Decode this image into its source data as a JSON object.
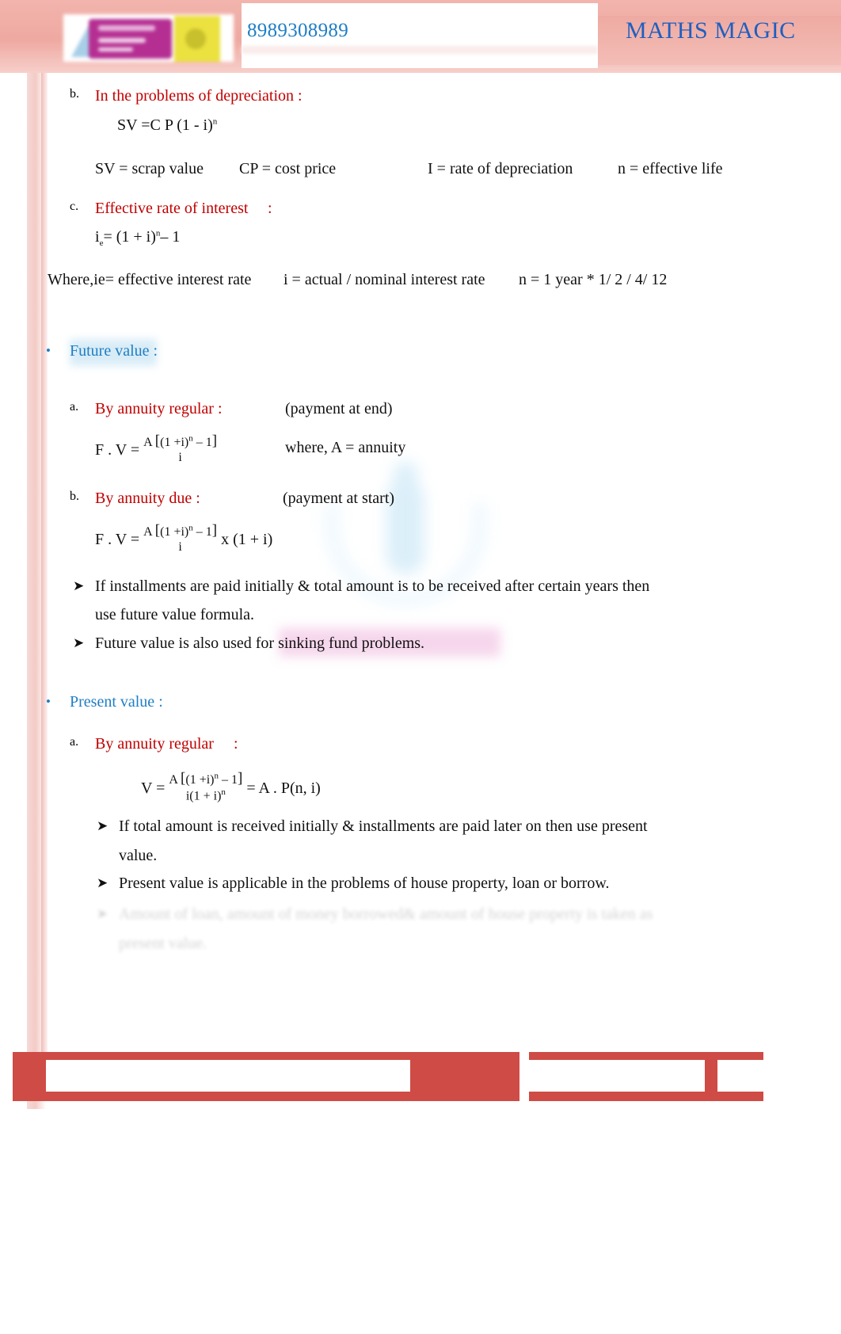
{
  "header": {
    "phone": "8989308989",
    "brand": "MATHS MAGIC",
    "logo_name": "maths-magic-logo"
  },
  "sections": {
    "depreciation": {
      "marker": "b.",
      "title": "In the problems of depreciation :",
      "formula": "SV =C P (1 - i)",
      "formula_exponent": "n",
      "legend": [
        "SV = scrap value",
        "CP = cost price",
        "I = rate of depreciation",
        "n = effective life"
      ]
    },
    "effective_rate": {
      "marker": "c.",
      "title": "Effective rate of interest",
      "colon": ":",
      "formula_lhs": "i",
      "formula_lhs_sub": "e",
      "formula_rhs": "=  (1 + i)",
      "formula_exponent": "n",
      "formula_tail": "– 1",
      "where_line": {
        "prefix": "Where,ie=  effective interest rate",
        "middle": "i = actual / nominal interest rate",
        "suffix": "n = 1 year * 1/ 2 / 4/ 12"
      }
    },
    "future_value": {
      "bullet": "•",
      "heading": "Future value :",
      "items": [
        {
          "marker": "a.",
          "title": "By annuity regular :",
          "note": "(payment at end)",
          "formula_lhs": "F . V =",
          "frac_num_a": "A",
          "frac_num_open": "[",
          "frac_num_b": "(1 +i)",
          "frac_num_pow": "n",
          "frac_num_c": "– 1",
          "frac_num_close": "]",
          "frac_den": "i",
          "formula_tail": "",
          "side_note": "where, A = annuity"
        },
        {
          "marker": "b.",
          "title": "By annuity due :",
          "note": "(payment at start)",
          "formula_lhs": "F . V =",
          "frac_num_a": "A",
          "frac_num_open": "[",
          "frac_num_b": "(1 +i)",
          "frac_num_pow": "n",
          "frac_num_c": "– 1",
          "frac_num_close": "]",
          "frac_den": "i",
          "formula_tail": "x (1 + i)",
          "side_note": ""
        }
      ],
      "notes": [
        "If installments are paid initially & total amount is to be received after certain years then",
        "use future value formula.",
        "Future value is also used for sinking fund problems."
      ]
    },
    "present_value": {
      "bullet": "•",
      "heading": "Present value :",
      "item": {
        "marker": "a.",
        "title": "By annuity regular",
        "colon": ":",
        "formula_lhs": "V =",
        "frac_num_a": "A",
        "frac_num_open": "[",
        "frac_num_b": "(1 +i)",
        "frac_num_pow": "n",
        "frac_num_c": "– 1",
        "frac_num_close": "]",
        "frac_den_a": "i",
        "frac_den_b": "(1 + i)",
        "frac_den_pow": "n",
        "equals_tail": "=  A . P(n, i)"
      },
      "notes": [
        "If total amount is received initially & installments are paid later on then use present",
        "value.",
        "Present value is applicable in the problems of house property, loan or borrow.",
        "Amount of loan, amount of money borrowed& amount of house property is taken as",
        "present value."
      ]
    }
  },
  "colors": {
    "red": "#c00000",
    "blue": "#1f7ec4",
    "header_pink": "#eea9a1",
    "footer_red": "#cf4b45",
    "brand_blue": "#1f5fc0"
  }
}
